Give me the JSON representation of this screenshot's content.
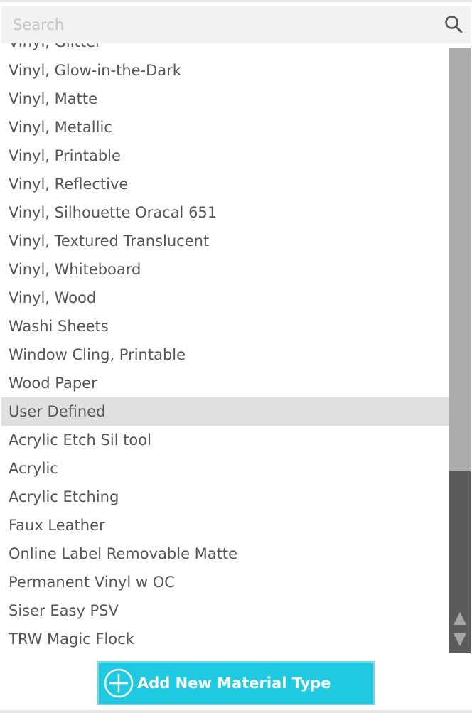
{
  "search": {
    "placeholder": "Search",
    "value": "",
    "icon": "search-icon"
  },
  "materials": [
    {
      "label": "Vinyl, Glitter",
      "selected": false
    },
    {
      "label": "Vinyl, Glow-in-the-Dark",
      "selected": false
    },
    {
      "label": "Vinyl, Matte",
      "selected": false
    },
    {
      "label": "Vinyl, Metallic",
      "selected": false
    },
    {
      "label": "Vinyl, Printable",
      "selected": false
    },
    {
      "label": "Vinyl, Reflective",
      "selected": false
    },
    {
      "label": "Vinyl, Silhouette Oracal 651",
      "selected": false
    },
    {
      "label": "Vinyl, Textured Translucent",
      "selected": false
    },
    {
      "label": "Vinyl, Whiteboard",
      "selected": false
    },
    {
      "label": "Vinyl, Wood",
      "selected": false
    },
    {
      "label": "Washi Sheets",
      "selected": false
    },
    {
      "label": "Window Cling, Printable",
      "selected": false
    },
    {
      "label": "Wood Paper",
      "selected": false
    },
    {
      "label": "User Defined",
      "selected": true
    },
    {
      "label": "Acrylic Etch Sil tool",
      "selected": false
    },
    {
      "label": "Acrylic",
      "selected": false
    },
    {
      "label": "Acrylic Etching",
      "selected": false
    },
    {
      "label": "Faux Leather",
      "selected": false
    },
    {
      "label": "Online Label Removable Matte",
      "selected": false
    },
    {
      "label": "Permanent Vinyl w OC",
      "selected": false
    },
    {
      "label": "Siser Easy PSV",
      "selected": false
    },
    {
      "label": "TRW Magic Flock",
      "selected": false
    }
  ],
  "scrollbar": {
    "position_fraction": 0.0,
    "visible_fraction": 0.7
  },
  "add_button": {
    "label": "Add New Material Type",
    "icon": "plus-circle-icon",
    "color": "#1ec9e1"
  },
  "colors": {
    "selected_row": "#e0e0e0",
    "scroll_track": "#5b5b5b",
    "scroll_thumb": "#acacac"
  }
}
